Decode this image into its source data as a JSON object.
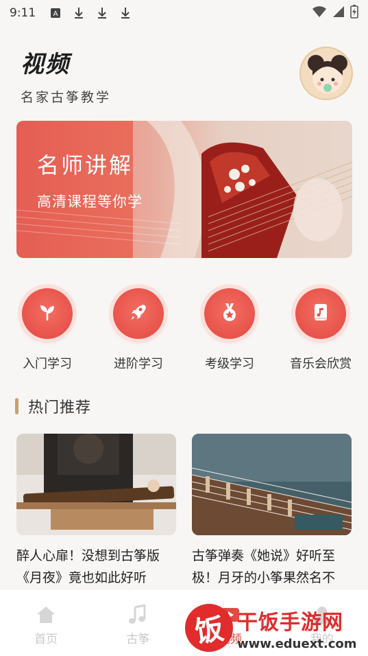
{
  "status_bar": {
    "time": "9:11",
    "icons": [
      "a-badge-icon",
      "download-icon",
      "download-icon",
      "download-icon",
      "wifi-icon",
      "signal-icon",
      "battery-charging-icon"
    ]
  },
  "header": {
    "title": "视频",
    "subtitle": "名家古筝教学"
  },
  "banner": {
    "title": "名师讲解",
    "subtitle": "高清课程等你学"
  },
  "categories": [
    {
      "label": "入门学习",
      "icon": "leaf-icon"
    },
    {
      "label": "进阶学习",
      "icon": "rocket-icon"
    },
    {
      "label": "考级学习",
      "icon": "medal-icon"
    },
    {
      "label": "音乐会欣赏",
      "icon": "music-book-icon"
    }
  ],
  "section": {
    "title": "热门推荐"
  },
  "cards": [
    {
      "title": "醉人心扉！没想到古筝版《月夜》竟也如此好听"
    },
    {
      "title": "古筝弹奏《她说》好听至极！月牙的小筝果然名不"
    }
  ],
  "tabbar": {
    "tabs": [
      {
        "label": "首页",
        "icon": "home-icon"
      },
      {
        "label": "古筝",
        "icon": "music-note-icon"
      },
      {
        "label": "视频",
        "icon": "video-icon"
      },
      {
        "label": "我的",
        "icon": "user-icon"
      }
    ],
    "active": 2
  },
  "watermark": {
    "logo_char": "饭",
    "name": "干饭手游网",
    "url": "www.eduext.com"
  },
  "colors": {
    "accent": "#e8534b",
    "section_bar": "#c8a070",
    "background": "#f7f6f5"
  }
}
